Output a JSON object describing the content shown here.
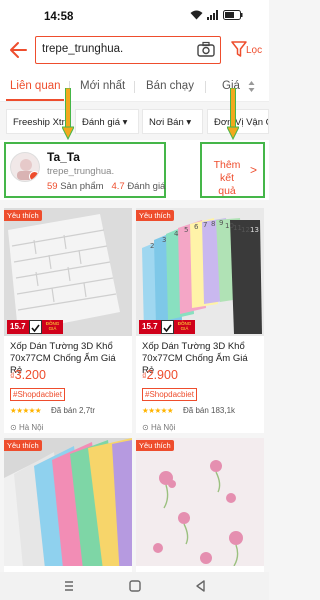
{
  "status_bar": {
    "time": "14:58",
    "battery": "58"
  },
  "search": {
    "query": "trepe_trunghua.",
    "filter_label": "Lọc"
  },
  "tabs": [
    {
      "label": "Liên quan",
      "active": true
    },
    {
      "label": "Mới nhất",
      "active": false
    },
    {
      "label": "Bán chạy",
      "active": false
    },
    {
      "label": "Giá",
      "active": false
    }
  ],
  "chips": [
    "Freeship Xtra",
    "Đánh giá",
    "Nơi Bán",
    "Đơn Vị Vận Chuyển"
  ],
  "shop": {
    "name": "Ta_Ta",
    "handle": "trepe_trunghua.",
    "products_count": "59",
    "products_label": "Sản phẩm",
    "rating": "4.7",
    "rating_label": "Đánh giá",
    "more_label": "Thêm kết quả"
  },
  "products": [
    {
      "badge": "Yêu thích",
      "promo_value": "15.7",
      "promo_text": "ĐỒNG GIÁ",
      "title": "Xốp Dán Tường 3D Khổ 70x77CM Chống Ẩm Giá Rẻ",
      "currency": "₫",
      "price": "3.200",
      "shop_tag": "#Shopdacbiet",
      "stars": "★★★★★",
      "sold": "Đã bán 2,7tr",
      "location": "Hà Nội"
    },
    {
      "badge": "Yêu thích",
      "promo_value": "15.7",
      "promo_text": "ĐỒNG GIÁ",
      "title": "Xốp Dán Tường 3D Khổ 70x77CM Chống Ẩm Giá Rẻ",
      "currency": "₫",
      "price": "2.900",
      "shop_tag": "#Shopdacbiet",
      "stars": "★★★★★",
      "sold": "Đã bán 183,1k",
      "location": "Hà Nội",
      "swatch_numbers": [
        "2",
        "3",
        "4",
        "5",
        "6",
        "7",
        "8",
        "9",
        "10",
        "11",
        "12",
        "13"
      ]
    },
    {
      "badge": "Yêu thích"
    },
    {
      "badge": "Yêu thích"
    }
  ],
  "colors": {
    "accent": "#ee4d2d",
    "highlight": "#45b649",
    "arrow": "#f2a81d"
  }
}
